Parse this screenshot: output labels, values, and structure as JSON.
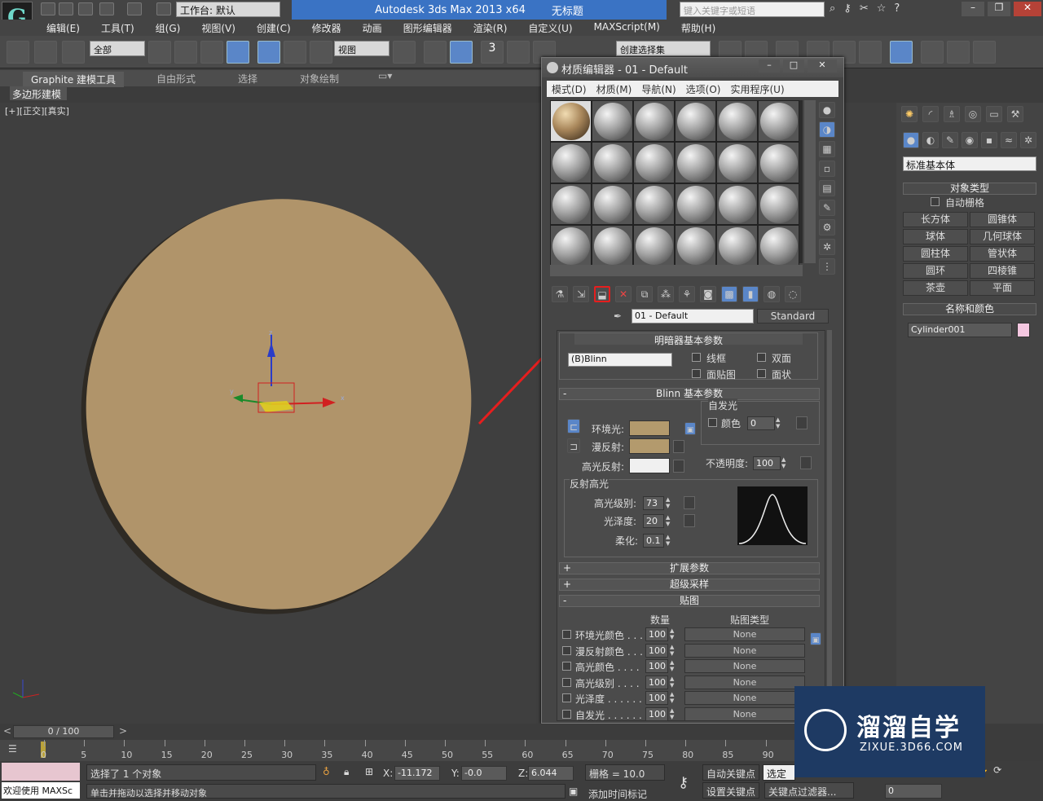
{
  "app": {
    "title": "Autodesk 3ds Max  2013 x64",
    "doc": "无标题",
    "workspace": "工作台: 默认",
    "search_placeholder": "键入关键字或短语"
  },
  "menu": [
    "编辑(E)",
    "工具(T)",
    "组(G)",
    "视图(V)",
    "创建(C)",
    "修改器",
    "动画",
    "图形编辑器",
    "渲染(R)",
    "自定义(U)",
    "MAXScript(M)",
    "帮助(H)"
  ],
  "toolbar": {
    "filter": "全部",
    "refcoord": "视图",
    "selset": "创建选择集",
    "snap_label": "3"
  },
  "ribbon": {
    "tabs": [
      "Graphite 建模工具",
      "自由形式",
      "选择",
      "对象绘制"
    ],
    "sub": "多边形建模"
  },
  "viewport": {
    "label": "[+][正交][真实]",
    "axis_x": "x",
    "axis_y": "y",
    "axis_z": "z"
  },
  "material_editor": {
    "title": "材质编辑器 - 01 - Default",
    "menu": [
      "模式(D)",
      "材质(M)",
      "导航(N)",
      "选项(O)",
      "实用程序(U)"
    ],
    "material_name": "01 - Default",
    "material_type": "Standard",
    "shader_section": "明暗器基本参数",
    "shader": "(B)Blinn",
    "shader_opts": [
      "线框",
      "双面",
      "面贴图",
      "面状"
    ],
    "blinn_section": "Blinn 基本参数",
    "self_illum_title": "自发光",
    "self_illum_color": "颜色",
    "self_illum_value": "0",
    "ambient": "环境光:",
    "diffuse": "漫反射:",
    "specular": "高光反射:",
    "opacity_label": "不透明度:",
    "opacity_value": "100",
    "highlight_title": "反射高光",
    "spec_level_label": "高光级别:",
    "spec_level": "73",
    "gloss_label": "光泽度:",
    "gloss": "20",
    "soften_label": "柔化:",
    "soften": "0.1",
    "extended": "扩展参数",
    "supersample": "超级采样",
    "maps": "贴图",
    "maps_header_amount": "数量",
    "maps_header_type": "贴图类型",
    "map_rows": [
      {
        "name": "环境光颜色 . . .",
        "amount": "100",
        "map": "None"
      },
      {
        "name": "漫反射颜色 . . .",
        "amount": "100",
        "map": "None"
      },
      {
        "name": "高光颜色  . . . .",
        "amount": "100",
        "map": "None"
      },
      {
        "name": "高光级别  . . . .",
        "amount": "100",
        "map": "None"
      },
      {
        "name": "光泽度 . . . . . .",
        "amount": "100",
        "map": "None"
      },
      {
        "name": "自发光 . . . . . .",
        "amount": "100",
        "map": "None"
      }
    ],
    "colors": {
      "ambient": "#b39a6d",
      "diffuse": "#b39a6d",
      "specular": "#f0f0f0"
    }
  },
  "command_panel": {
    "dropdown": "标准基本体",
    "object_type": "对象类型",
    "autogrid": "自动栅格",
    "buttons": [
      "长方体",
      "圆锥体",
      "球体",
      "几何球体",
      "圆柱体",
      "管状体",
      "圆环",
      "四棱锥",
      "茶壶",
      "平面"
    ],
    "name_color": "名称和颜色",
    "object_name": "Cylinder001",
    "object_color": "#f4c7e0"
  },
  "timeline": {
    "frame": "0 / 100",
    "ticks": [
      "0",
      "5",
      "10",
      "15",
      "20",
      "25",
      "30",
      "35",
      "40",
      "45",
      "50",
      "55",
      "60",
      "65",
      "70",
      "75",
      "80",
      "85",
      "90"
    ]
  },
  "status": {
    "selected": "选择了 1 个对象",
    "prompt": "单击并拖动以选择并移动对象",
    "welcome": "欢迎使用 MAXSc",
    "x_label": "X:",
    "x": "-11.172",
    "y_label": "Y:",
    "y": "-0.0",
    "z_label": "Z:",
    "z": "6.044",
    "grid": "栅格 = 10.0",
    "addtime": "添加时间标记",
    "autokey": "自动关键点",
    "setkey": "设置关键点",
    "selected_dd": "选定对",
    "keyfilter": "关键点过滤器...",
    "frame_field": "0"
  },
  "watermark": {
    "brand": "溜溜自学",
    "url": "ZIXUE.3D66.COM"
  }
}
